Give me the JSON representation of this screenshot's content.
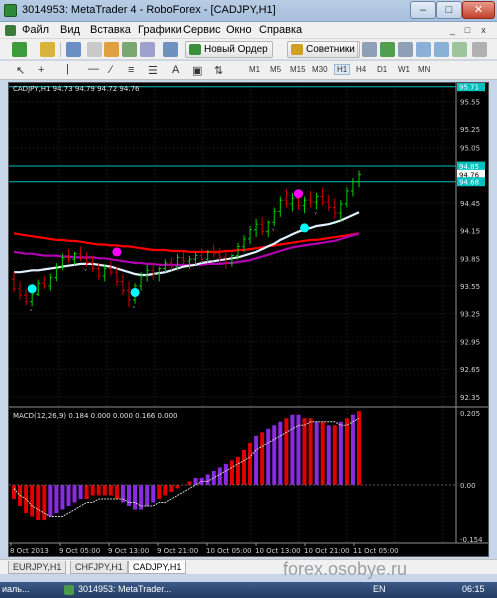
{
  "window": {
    "title": "3014953: MetaTrader 4 - RoboForex - [CADJPY,H1]",
    "controls": {
      "minimize": "–",
      "maximize": "□",
      "close": "✕"
    }
  },
  "menu": {
    "items": [
      "Файл",
      "Вид",
      "Вставка",
      "Графики",
      "Сервис",
      "Окно",
      "Справка"
    ],
    "mdi": {
      "minimize": "_",
      "restore": "□",
      "close": "x"
    }
  },
  "toolbar": {
    "new_order": "Новый Ордер",
    "advisors": "Советники"
  },
  "timeframes": [
    "M1",
    "M5",
    "M15",
    "M30",
    "H1",
    "H4",
    "D1",
    "W1",
    "MN"
  ],
  "active_timeframe": "H1",
  "tools": {
    "text_tool": "A"
  },
  "chart_data": {
    "type": "candlestick",
    "symbol_header": "CADJPY,H1  94.73 94.79 94.72 94.76",
    "price_axis": [
      "95.55",
      "95.25",
      "95.05",
      "94.85",
      "94.45",
      "94.15",
      "93.85",
      "93.55",
      "93.25",
      "92.95",
      "92.65",
      "92.35"
    ],
    "price_range": [
      92.25,
      95.75
    ],
    "price_labels": [
      {
        "value": 95.71,
        "text": "95.71",
        "color": "#00c0c0"
      },
      {
        "value": 94.85,
        "text": "94.85",
        "color": "#00c0c0"
      },
      {
        "value": 94.76,
        "text": "94.76",
        "color": "#000000"
      },
      {
        "value": 94.68,
        "text": "94.68",
        "color": "#00c0c0"
      }
    ],
    "level_lines": [
      95.71,
      94.85,
      94.68
    ],
    "ohlc": [
      [
        93.62,
        93.7,
        93.48,
        93.52
      ],
      [
        93.52,
        93.6,
        93.4,
        93.45
      ],
      [
        93.45,
        93.52,
        93.34,
        93.38
      ],
      [
        93.38,
        93.5,
        93.33,
        93.46
      ],
      [
        93.46,
        93.62,
        93.44,
        93.58
      ],
      [
        93.58,
        93.66,
        93.52,
        93.55
      ],
      [
        93.55,
        93.68,
        93.5,
        93.64
      ],
      [
        93.64,
        93.8,
        93.6,
        93.76
      ],
      [
        93.76,
        93.9,
        93.72,
        93.86
      ],
      [
        93.86,
        93.95,
        93.8,
        93.84
      ],
      [
        93.84,
        93.92,
        93.78,
        93.9
      ],
      [
        93.9,
        93.98,
        93.82,
        93.85
      ],
      [
        93.85,
        93.92,
        93.76,
        93.8
      ],
      [
        93.8,
        93.88,
        93.7,
        93.74
      ],
      [
        93.74,
        93.8,
        93.62,
        93.66
      ],
      [
        93.66,
        93.78,
        93.6,
        93.74
      ],
      [
        93.74,
        93.82,
        93.66,
        93.7
      ],
      [
        93.7,
        93.76,
        93.55,
        93.6
      ],
      [
        93.6,
        93.68,
        93.45,
        93.5
      ],
      [
        93.5,
        93.6,
        93.32,
        93.4
      ],
      [
        93.4,
        93.58,
        93.36,
        93.55
      ],
      [
        93.55,
        93.7,
        93.5,
        93.66
      ],
      [
        93.66,
        93.78,
        93.6,
        93.72
      ],
      [
        93.72,
        93.8,
        93.62,
        93.68
      ],
      [
        93.68,
        93.76,
        93.6,
        93.74
      ],
      [
        93.74,
        93.84,
        93.7,
        93.8
      ],
      [
        93.8,
        93.86,
        93.72,
        93.76
      ],
      [
        93.76,
        93.9,
        93.72,
        93.86
      ],
      [
        93.86,
        93.92,
        93.78,
        93.82
      ],
      [
        93.82,
        93.88,
        93.74,
        93.84
      ],
      [
        93.84,
        93.92,
        93.78,
        93.88
      ],
      [
        93.88,
        93.96,
        93.8,
        93.84
      ],
      [
        93.84,
        93.94,
        93.8,
        93.92
      ],
      [
        93.92,
        94.0,
        93.86,
        93.9
      ],
      [
        93.9,
        93.96,
        93.8,
        93.86
      ],
      [
        93.86,
        93.92,
        93.74,
        93.8
      ],
      [
        93.8,
        93.9,
        93.76,
        93.88
      ],
      [
        93.88,
        94.02,
        93.84,
        93.98
      ],
      [
        93.98,
        94.1,
        93.92,
        94.06
      ],
      [
        94.06,
        94.2,
        94.0,
        94.16
      ],
      [
        94.16,
        94.28,
        94.08,
        94.22
      ],
      [
        94.22,
        94.3,
        94.1,
        94.14
      ],
      [
        94.14,
        94.26,
        94.08,
        94.24
      ],
      [
        94.24,
        94.4,
        94.2,
        94.36
      ],
      [
        94.36,
        94.52,
        94.3,
        94.48
      ],
      [
        94.48,
        94.6,
        94.4,
        94.44
      ],
      [
        94.44,
        94.56,
        94.36,
        94.5
      ],
      [
        94.5,
        94.58,
        94.38,
        94.42
      ],
      [
        94.42,
        94.52,
        94.34,
        94.48
      ],
      [
        94.48,
        94.58,
        94.4,
        94.46
      ],
      [
        94.46,
        94.56,
        94.38,
        94.52
      ],
      [
        94.52,
        94.62,
        94.42,
        94.46
      ],
      [
        94.46,
        94.54,
        94.36,
        94.4
      ],
      [
        94.4,
        94.5,
        94.28,
        94.34
      ],
      [
        94.34,
        94.48,
        94.26,
        94.44
      ],
      [
        94.44,
        94.62,
        94.4,
        94.58
      ],
      [
        94.58,
        94.72,
        94.52,
        94.68
      ],
      [
        94.68,
        94.8,
        94.62,
        94.76
      ]
    ],
    "ma_red": [
      94.12,
      94.11,
      94.1,
      94.09,
      94.08,
      94.07,
      94.06,
      94.05,
      94.05,
      94.04,
      94.04,
      94.03,
      94.02,
      94.01,
      94.0,
      94.0,
      93.99,
      93.99,
      93.98,
      93.98,
      93.97,
      93.96,
      93.95,
      93.94,
      93.94,
      93.94,
      93.93,
      93.93,
      93.93,
      93.92,
      93.92,
      93.92,
      93.92,
      93.92,
      93.92,
      93.93,
      93.93,
      93.94,
      93.94,
      93.95,
      93.96,
      93.97,
      93.98,
      93.99,
      94.0,
      94.01,
      94.02,
      94.03,
      94.04,
      94.05,
      94.05,
      94.06,
      94.07,
      94.08,
      94.09,
      94.1,
      94.11,
      94.12
    ],
    "ma_magenta": [
      93.92,
      93.91,
      93.9,
      93.9,
      93.89,
      93.88,
      93.88,
      93.88,
      93.87,
      93.87,
      93.86,
      93.86,
      93.86,
      93.86,
      93.85,
      93.85,
      93.84,
      93.83,
      93.82,
      93.81,
      93.8,
      93.8,
      93.79,
      93.79,
      93.78,
      93.78,
      93.78,
      93.78,
      93.78,
      93.78,
      93.78,
      93.78,
      93.79,
      93.79,
      93.79,
      93.8,
      93.8,
      93.81,
      93.82,
      93.83,
      93.85,
      93.87,
      93.89,
      93.91,
      93.93,
      93.95,
      93.97,
      93.98,
      93.99,
      94.0,
      94.01,
      94.02,
      94.03,
      94.04,
      94.06,
      94.08,
      94.1,
      94.12
    ],
    "ma_white": [
      93.7,
      93.7,
      93.71,
      93.72,
      93.72,
      93.73,
      93.74,
      93.75,
      93.76,
      93.77,
      93.78,
      93.79,
      93.79,
      93.79,
      93.78,
      93.77,
      93.76,
      93.74,
      93.72,
      93.7,
      93.68,
      93.67,
      93.67,
      93.68,
      93.69,
      93.7,
      93.72,
      93.74,
      93.76,
      93.77,
      93.78,
      93.8,
      93.81,
      93.82,
      93.83,
      93.84,
      93.85,
      93.86,
      93.88,
      93.9,
      93.92,
      93.95,
      93.98,
      94.01,
      94.05,
      94.08,
      94.11,
      94.14,
      94.16,
      94.18,
      94.2,
      94.21,
      94.22,
      94.24,
      94.26,
      94.29,
      94.32,
      94.35
    ],
    "cyan_dots": [
      {
        "i": 3,
        "v": 93.52
      },
      {
        "i": 20,
        "v": 93.48
      },
      {
        "i": 48,
        "v": 94.18
      }
    ],
    "magenta_dots": [
      {
        "i": 17,
        "v": 93.92
      },
      {
        "i": 47,
        "v": 94.55
      }
    ],
    "fractal_markers": [
      3,
      12,
      20,
      33,
      43,
      50
    ],
    "macd": {
      "label": "MACD(12,26,9) 0.184 0.000 0.000 0.166 0.000",
      "axis": [
        "0.205",
        "0.00",
        "-0.154"
      ],
      "range": [
        -0.154,
        0.205
      ],
      "hist": [
        -0.04,
        -0.06,
        -0.08,
        -0.09,
        -0.1,
        -0.1,
        -0.09,
        -0.08,
        -0.07,
        -0.06,
        -0.05,
        -0.04,
        -0.04,
        -0.03,
        -0.03,
        -0.03,
        -0.03,
        -0.04,
        -0.05,
        -0.06,
        -0.07,
        -0.07,
        -0.06,
        -0.05,
        -0.04,
        -0.03,
        -0.02,
        -0.01,
        0.0,
        0.01,
        0.02,
        0.02,
        0.03,
        0.04,
        0.05,
        0.06,
        0.07,
        0.08,
        0.1,
        0.12,
        0.14,
        0.15,
        0.16,
        0.17,
        0.18,
        0.19,
        0.2,
        0.2,
        0.19,
        0.19,
        0.18,
        0.18,
        0.17,
        0.17,
        0.18,
        0.19,
        0.2,
        0.21
      ],
      "signal": [
        -0.01,
        -0.03,
        -0.04,
        -0.06,
        -0.07,
        -0.08,
        -0.09,
        -0.09,
        -0.09,
        -0.08,
        -0.07,
        -0.06,
        -0.05,
        -0.05,
        -0.04,
        -0.04,
        -0.04,
        -0.04,
        -0.04,
        -0.05,
        -0.05,
        -0.06,
        -0.06,
        -0.06,
        -0.05,
        -0.05,
        -0.04,
        -0.03,
        -0.02,
        -0.01,
        0.0,
        0.01,
        0.01,
        0.02,
        0.03,
        0.04,
        0.05,
        0.06,
        0.07,
        0.08,
        0.1,
        0.11,
        0.12,
        0.13,
        0.14,
        0.15,
        0.16,
        0.17,
        0.17,
        0.18,
        0.18,
        0.18,
        0.18,
        0.18,
        0.17,
        0.17,
        0.18,
        0.19
      ]
    },
    "time_axis": [
      "8 Oct 2013",
      "9 Oct 05:00",
      "9 Oct 13:00",
      "9 Oct 21:00",
      "10 Oct 05:00",
      "10 Oct 13:00",
      "10 Oct 21:00",
      "11 Oct 05:00"
    ]
  },
  "tabs": [
    "EURJPY,H1",
    "CHFJPY,H1",
    "CADJPY,H1"
  ],
  "active_tab": "CADJPY,H1",
  "watermark": "forex.osobye.ru",
  "taskbar": {
    "items": [
      "иаль...",
      "3014953: MetaTrader..."
    ],
    "lang": "EN",
    "clock": "06:15"
  },
  "colors": {
    "bull": "#00d000",
    "bear": "#d00000",
    "ma_red": "#ff0000",
    "ma_magenta": "#b000b0",
    "ma_white": "#e0f0ff",
    "dot_cyan": "#00ffff",
    "dot_magenta": "#ff00ff",
    "macd_purple": "#8a2be2",
    "macd_red": "#e00000",
    "grid": "#2a2a2a",
    "level_line": "#00c0c0"
  }
}
